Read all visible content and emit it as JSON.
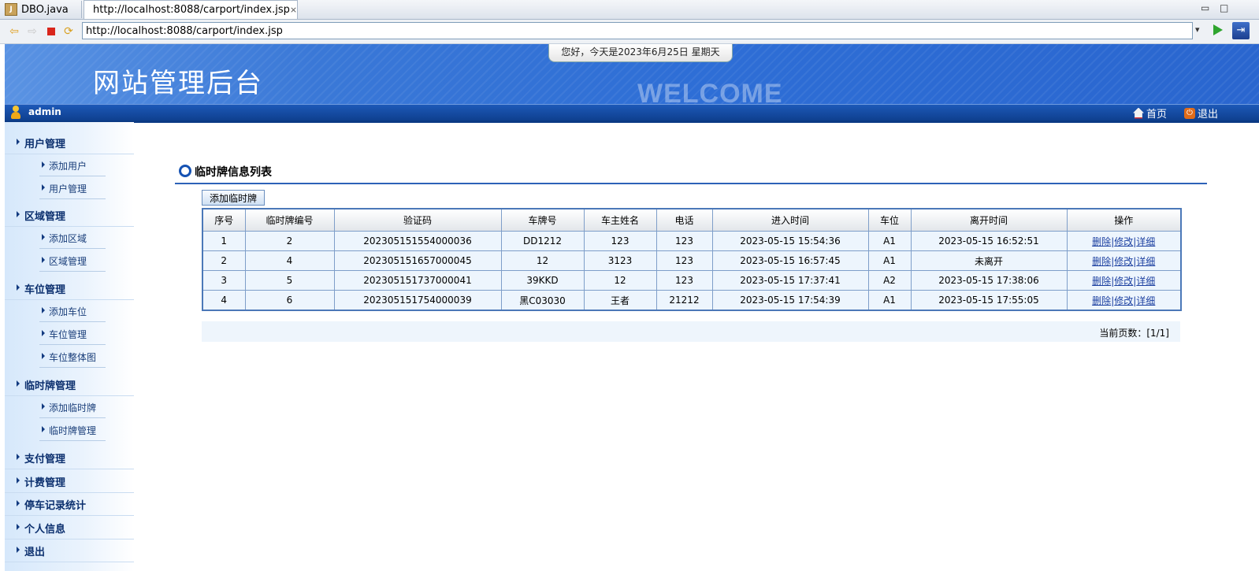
{
  "browser": {
    "tabs": [
      {
        "label": "DBO.java"
      },
      {
        "label": "http://localhost:8088/carport/index.jsp"
      }
    ],
    "url": "http://localhost:8088/carport/index.jsp"
  },
  "header": {
    "site_title": "网站管理后台",
    "welcome": "WELCOME",
    "date_text": "您好，今天是2023年6月25日 星期天",
    "user": "admin",
    "home_label": "首页",
    "logout_label": "退出"
  },
  "sidebar": {
    "groups": [
      {
        "label": "用户管理",
        "items": [
          {
            "label": "添加用户"
          },
          {
            "label": "用户管理"
          }
        ]
      },
      {
        "label": "区域管理",
        "items": [
          {
            "label": "添加区域"
          },
          {
            "label": "区域管理"
          }
        ]
      },
      {
        "label": "车位管理",
        "items": [
          {
            "label": "添加车位"
          },
          {
            "label": "车位管理"
          },
          {
            "label": "车位整体图"
          }
        ]
      },
      {
        "label": "临时牌管理",
        "items": [
          {
            "label": "添加临时牌"
          },
          {
            "label": "临时牌管理"
          }
        ]
      },
      {
        "label": "支付管理",
        "items": []
      },
      {
        "label": "计费管理",
        "items": []
      },
      {
        "label": "停车记录统计",
        "items": []
      },
      {
        "label": "个人信息",
        "items": []
      },
      {
        "label": "退出",
        "items": []
      }
    ]
  },
  "main": {
    "title": "临时牌信息列表",
    "add_button": "添加临时牌",
    "columns": [
      "序号",
      "临时牌编号",
      "验证码",
      "车牌号",
      "车主姓名",
      "电话",
      "进入时间",
      "车位",
      "离开时间",
      "操作"
    ],
    "rows": [
      [
        "1",
        "2",
        "202305151554000036",
        "DD1212",
        "123",
        "123",
        "2023-05-15 15:54:36",
        "A1",
        "2023-05-15 16:52:51"
      ],
      [
        "2",
        "4",
        "202305151657000045",
        "12",
        "3123",
        "123",
        "2023-05-15 16:57:45",
        "A1",
        "未离开"
      ],
      [
        "3",
        "5",
        "202305151737000041",
        "39KKD",
        "12",
        "123",
        "2023-05-15 17:37:41",
        "A2",
        "2023-05-15 17:38:06"
      ],
      [
        "4",
        "6",
        "202305151754000039",
        "黑C03030",
        "王者",
        "21212",
        "2023-05-15 17:54:39",
        "A1",
        "2023-05-15 17:55:05"
      ]
    ],
    "actions": {
      "delete": "删除",
      "edit": "修改",
      "detail": "详细",
      "sep": "|"
    },
    "pager": "当前页数：[1/1]"
  }
}
